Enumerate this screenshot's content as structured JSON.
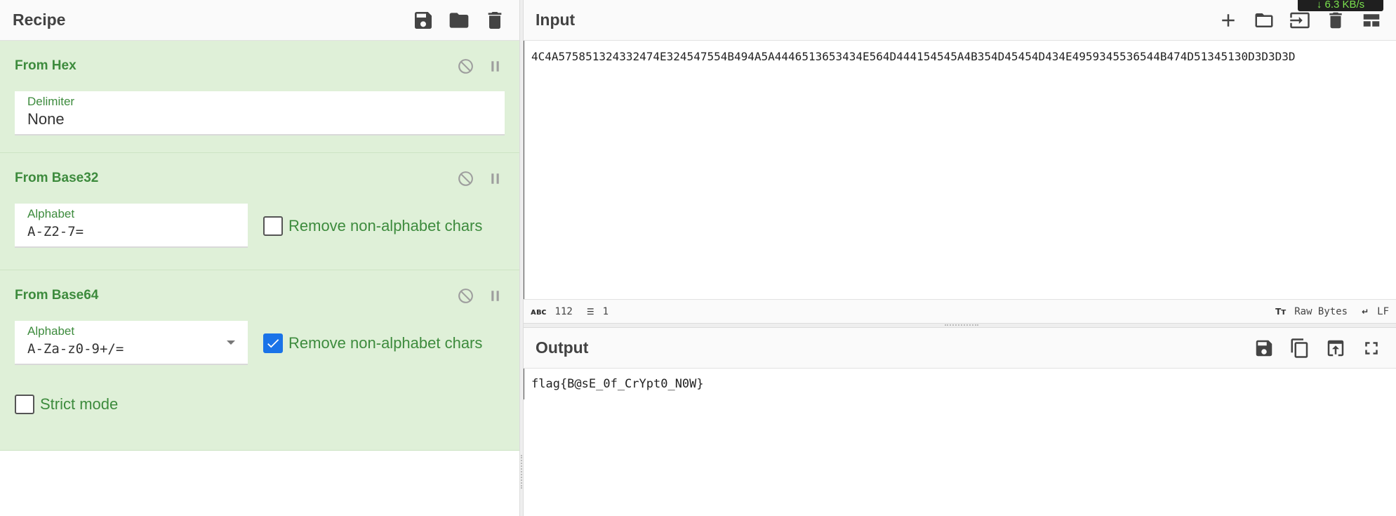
{
  "recipe": {
    "title": "Recipe",
    "icons": [
      "save-icon",
      "folder-icon",
      "trash-icon"
    ],
    "operations": [
      {
        "title": "From Hex",
        "fields": [
          {
            "label": "Delimiter",
            "value": "None"
          }
        ]
      },
      {
        "title": "From Base32",
        "fields": [
          {
            "label": "Alphabet",
            "value": "A-Z2-7="
          }
        ],
        "checkbox": {
          "label": "Remove non-alphabet chars",
          "checked": false
        }
      },
      {
        "title": "From Base64",
        "fields": [
          {
            "label": "Alphabet",
            "value": "A-Za-z0-9+/="
          }
        ],
        "checkbox": {
          "label": "Remove non-alphabet chars",
          "checked": true
        },
        "extra_checkbox": {
          "label": "Strict mode",
          "checked": false
        }
      }
    ]
  },
  "input": {
    "title": "Input",
    "text": "4C4A575851324332474E324547554B494A5A4446513653434E564D444154545A4B354D45454D434E4959345536544B474D51345130D3D3D3D",
    "status": {
      "length": "112",
      "lines": "1",
      "encoding": "Raw Bytes",
      "eol": "LF"
    }
  },
  "output": {
    "title": "Output",
    "text": "flag{B@sE_0f_CrYpt0_N0W}"
  },
  "network": {
    "rate": "↓ 6.3 KB/s"
  },
  "colors": {
    "op_bg": "#dff0d8",
    "op_title": "#3d8b3d",
    "checkbox_on": "#1a73e8"
  }
}
